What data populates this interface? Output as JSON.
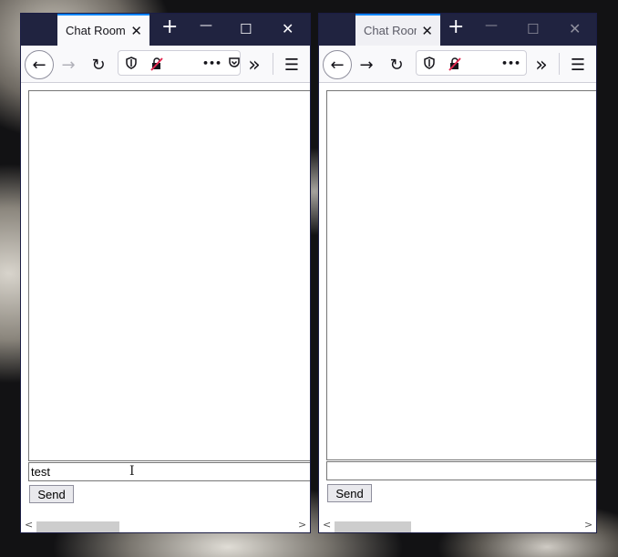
{
  "windows": [
    {
      "id": "left",
      "tab_title": "Chat Room",
      "message_input_value": "test",
      "send_label": "Send",
      "forward_enabled": false
    },
    {
      "id": "right",
      "tab_title": "Chat Room",
      "message_input_value": "",
      "send_label": "Send",
      "forward_enabled": true
    }
  ],
  "icons": {
    "close_tab": "✕",
    "new_tab": "+",
    "minimize": "—",
    "maximize": "☐",
    "close_window": "✕",
    "back": "←",
    "forward": "→",
    "reload": "↻",
    "more": "•••",
    "overflow": "»",
    "menu": "☰"
  },
  "colors": {
    "titlebar": "#202340",
    "tab_accent": "#0a84ff",
    "toolbar": "#f9f9fb"
  }
}
